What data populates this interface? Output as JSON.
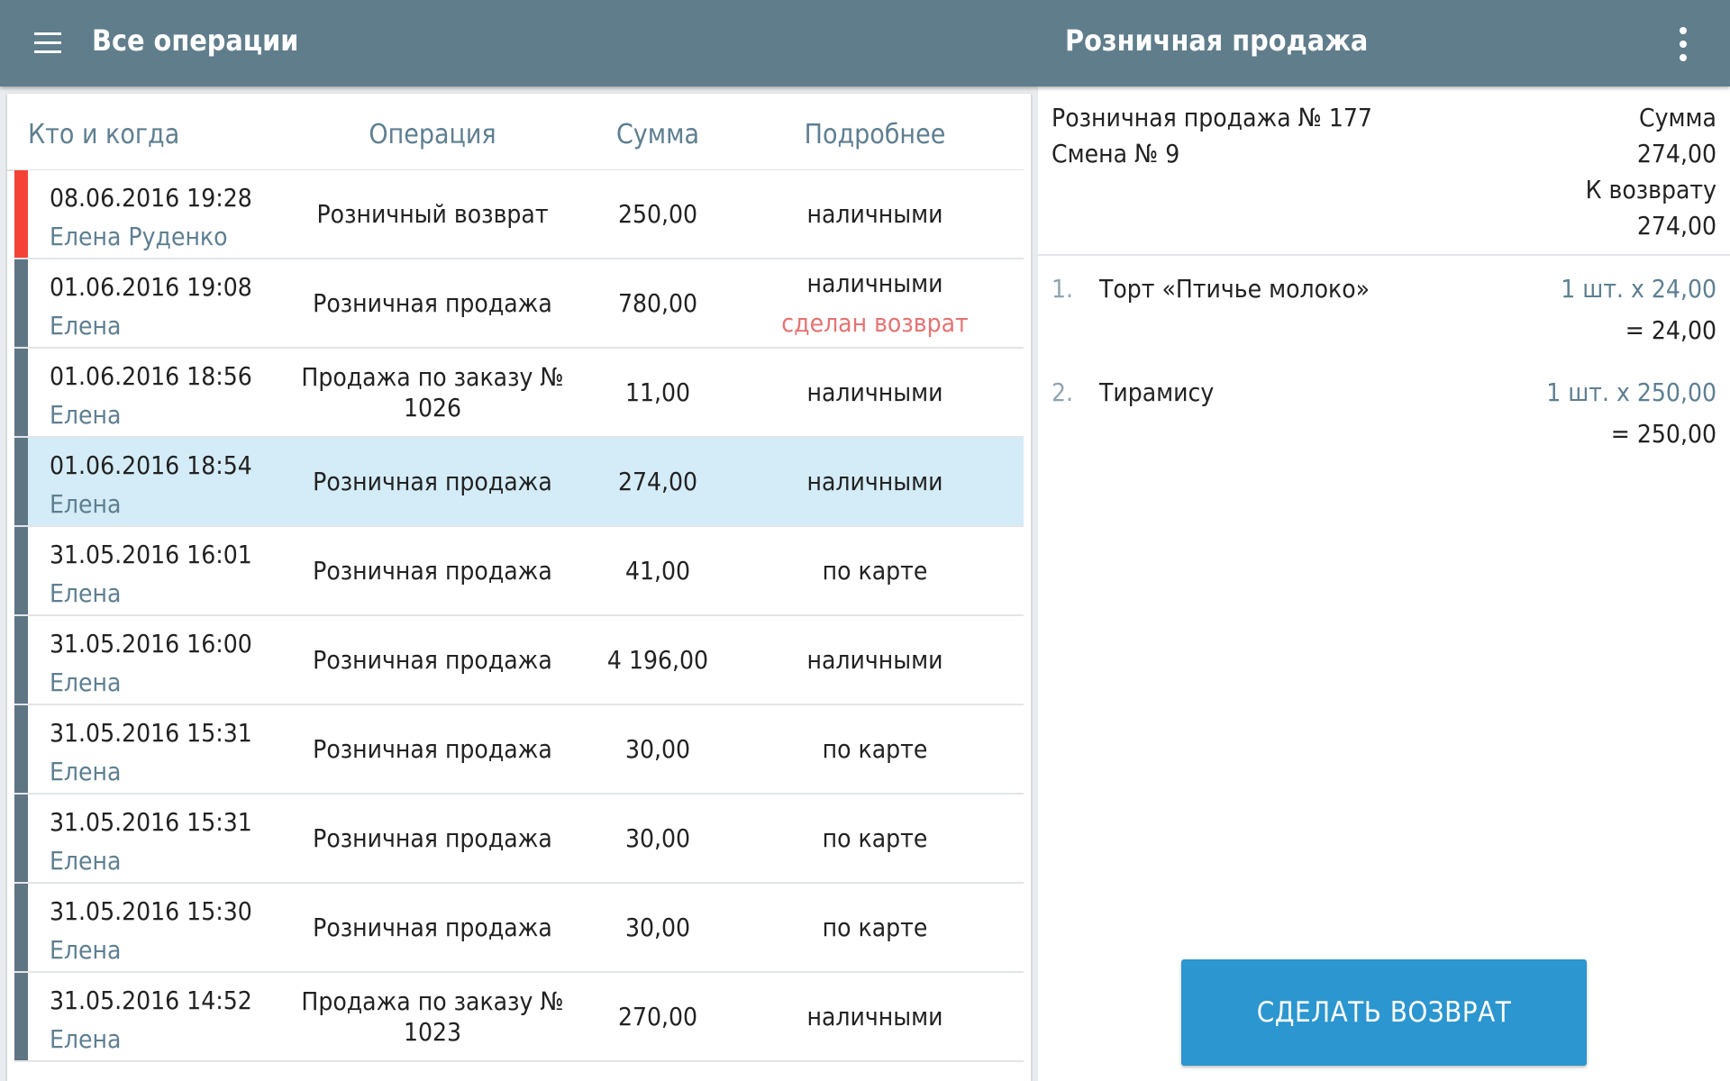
{
  "appbar": {
    "title": "Все операции",
    "detail_title": "Розничная продажа",
    "menu_icon": "hamburger-menu-icon",
    "more_icon": "more-vertical-icon"
  },
  "table": {
    "headers": [
      "Кто и когда",
      "Операция",
      "Сумма",
      "Подробнее"
    ],
    "rows": [
      {
        "date": "08.06.2016 19:28",
        "user": "Елена Руденко",
        "operation": "Розничный возврат",
        "sum": "250,00",
        "details": "наличными",
        "note": "",
        "type": "refund",
        "selected": false
      },
      {
        "date": "01.06.2016 19:08",
        "user": "Елена",
        "operation": "Розничная продажа",
        "sum": "780,00",
        "details": "наличными",
        "note": "сделан возврат",
        "type": "sale",
        "selected": false
      },
      {
        "date": "01.06.2016 18:56",
        "user": "Елена",
        "operation": "Продажа по заказу № 1026",
        "sum": "11,00",
        "details": "наличными",
        "note": "",
        "type": "sale",
        "selected": false
      },
      {
        "date": "01.06.2016 18:54",
        "user": "Елена",
        "operation": "Розничная продажа",
        "sum": "274,00",
        "details": "наличными",
        "note": "",
        "type": "sale",
        "selected": true
      },
      {
        "date": "31.05.2016 16:01",
        "user": "Елена",
        "operation": "Розничная продажа",
        "sum": "41,00",
        "details": "по карте",
        "note": "",
        "type": "sale",
        "selected": false
      },
      {
        "date": "31.05.2016 16:00",
        "user": "Елена",
        "operation": "Розничная продажа",
        "sum": "4 196,00",
        "details": "наличными",
        "note": "",
        "type": "sale",
        "selected": false
      },
      {
        "date": "31.05.2016 15:31",
        "user": "Елена",
        "operation": "Розничная продажа",
        "sum": "30,00",
        "details": "по карте",
        "note": "",
        "type": "sale",
        "selected": false
      },
      {
        "date": "31.05.2016 15:31",
        "user": "Елена",
        "operation": "Розничная продажа",
        "sum": "30,00",
        "details": "по карте",
        "note": "",
        "type": "sale",
        "selected": false
      },
      {
        "date": "31.05.2016 15:30",
        "user": "Елена",
        "operation": "Розничная продажа",
        "sum": "30,00",
        "details": "по карте",
        "note": "",
        "type": "sale",
        "selected": false
      },
      {
        "date": "31.05.2016 14:52",
        "user": "Елена",
        "operation": "Продажа по заказу № 1023",
        "sum": "270,00",
        "details": "наличными",
        "note": "",
        "type": "sale",
        "selected": false
      }
    ]
  },
  "detail": {
    "sale_number": "Розничная продажа № 177",
    "shift": "Смена № 9",
    "sum_label": "Сумма",
    "sum_value": "274,00",
    "return_label": "К возврату",
    "return_value": "274,00",
    "items": [
      {
        "num": "1.",
        "name": "Торт «Птичье молоко»",
        "qty": "1 шт. х 24,00",
        "total": "= 24,00"
      },
      {
        "num": "2.",
        "name": "Тирамису",
        "qty": "1 шт. х 250,00",
        "total": "= 250,00"
      }
    ],
    "return_button": "СДЕЛАТЬ ВОЗВРАТ"
  },
  "colors": {
    "appbar": "#607d8b",
    "refund_stripe": "#f44336",
    "sale_stripe": "#5e7584",
    "selected_row": "#d4ecf7",
    "note_text": "#e57373",
    "button": "#2b96cf"
  }
}
